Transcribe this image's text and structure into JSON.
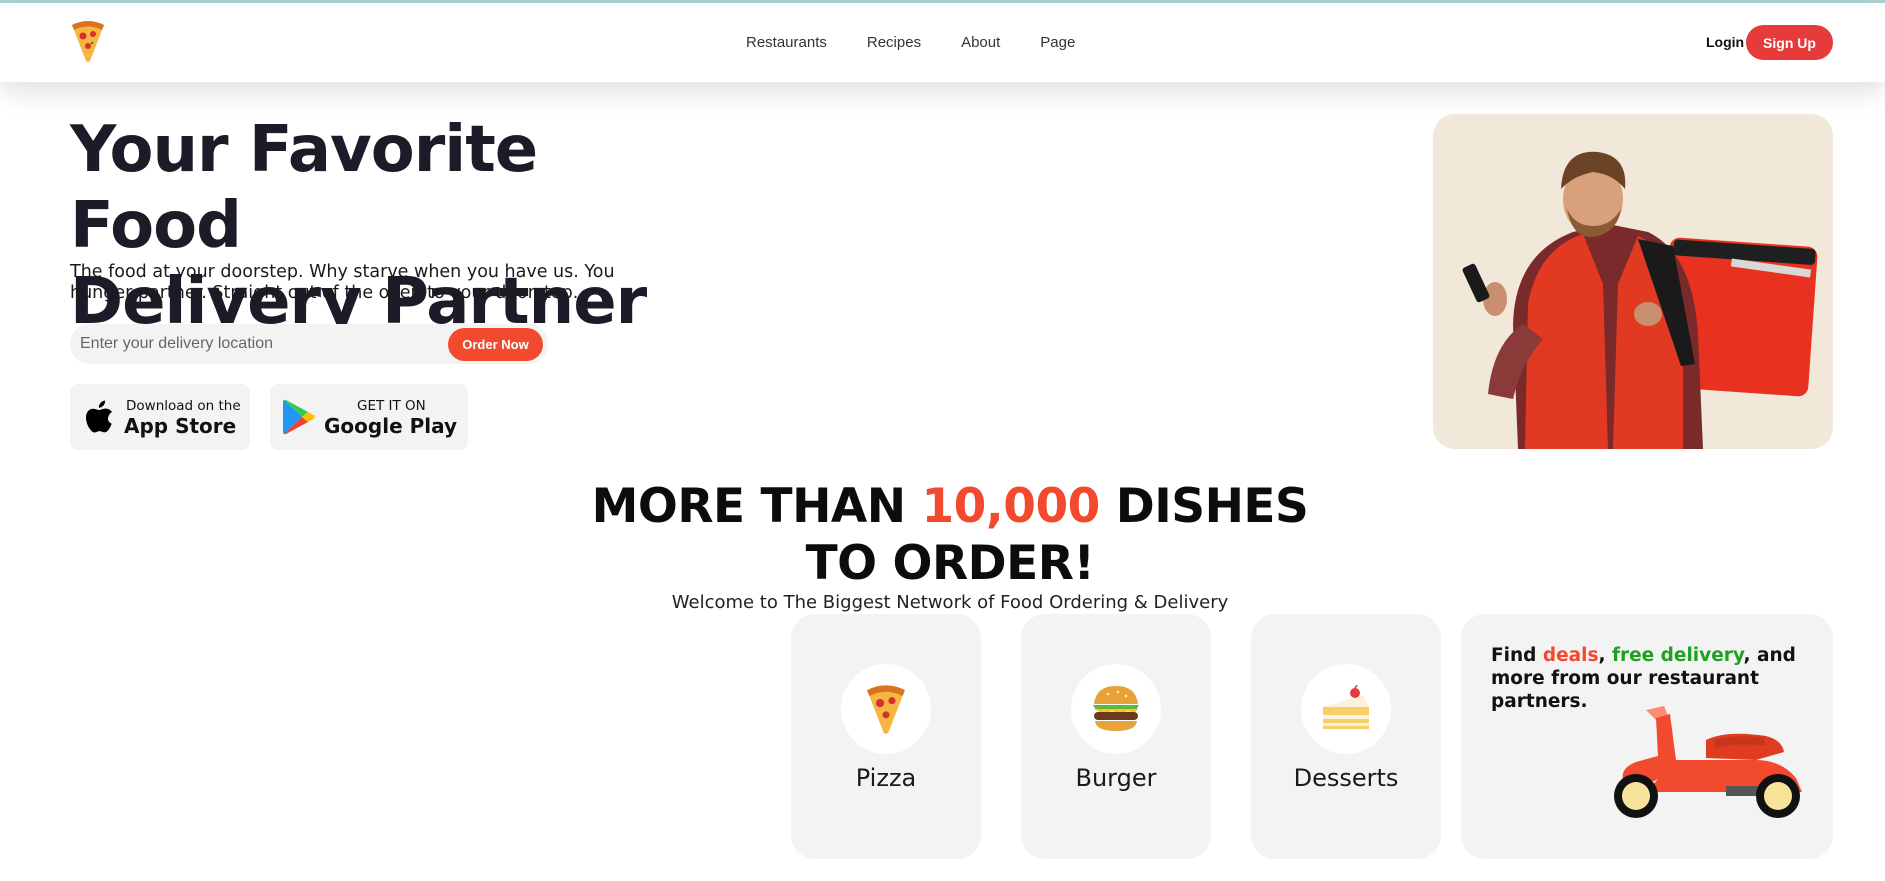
{
  "nav": {
    "links": [
      "Restaurants",
      "Recipes",
      "About",
      "Page"
    ],
    "login": "Login",
    "signup": "Sign Up"
  },
  "hero": {
    "title_line1": "Your Favorite Food",
    "title_line2": "Delivery Partner",
    "subtitle": "The food at your doorstep. Why starve when you have us. You hunger partner. Straight out of the oven to your doorstep.",
    "search_placeholder": "Enter your delivery location",
    "order_button": "Order Now",
    "app_store": {
      "small": "Download on the",
      "big": "App Store"
    },
    "google_play": {
      "small": "GET IT ON",
      "big": "Google Play"
    }
  },
  "section": {
    "title_pre": "MORE THAN ",
    "title_accent": "10,000",
    "title_post": " DISHES",
    "title_line2": "TO ORDER!",
    "subtitle": "Welcome to The Biggest Network of Food Ordering & Delivery"
  },
  "categories": [
    {
      "label": "Pizza",
      "icon": "pizza-icon"
    },
    {
      "label": "Burger",
      "icon": "burger-icon"
    },
    {
      "label": "Desserts",
      "icon": "cake-icon"
    }
  ],
  "promo": {
    "find": "Find ",
    "deals": "deals",
    "comma": ", ",
    "free_delivery": "free delivery",
    "rest": ", and more from our restaurant partners."
  },
  "colors": {
    "accent": "#f24a2f",
    "signup": "#e53b3b",
    "green": "#1fa11f",
    "card_bg": "#f3f3f3"
  }
}
